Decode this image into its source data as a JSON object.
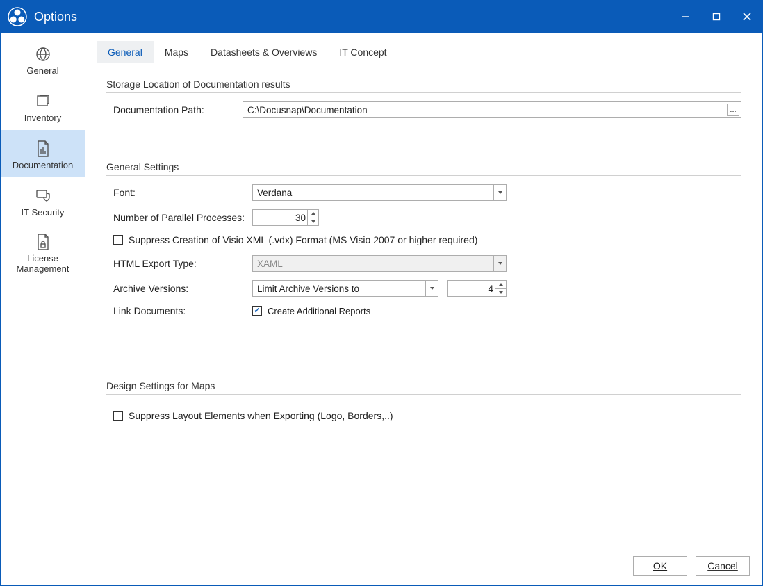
{
  "window": {
    "title": "Options"
  },
  "sidebar": {
    "items": [
      {
        "label": "General"
      },
      {
        "label": "Inventory"
      },
      {
        "label": "Documentation"
      },
      {
        "label": "IT Security"
      },
      {
        "label": "License Management"
      }
    ]
  },
  "tabs": [
    {
      "label": "General"
    },
    {
      "label": "Maps"
    },
    {
      "label": "Datasheets & Overviews"
    },
    {
      "label": "IT Concept"
    }
  ],
  "sections": {
    "storage": {
      "title": "Storage Location of Documentation results",
      "path_label": "Documentation Path:",
      "path_value": "C:\\Docusnap\\Documentation"
    },
    "general": {
      "title": "General Settings",
      "font_label": "Font:",
      "font_value": "Verdana",
      "procs_label": "Number of Parallel Processes:",
      "procs_value": "30",
      "suppress_visio": "Suppress Creation of Visio XML (.vdx) Format (MS Visio 2007 or higher required)",
      "export_type_label": "HTML Export Type:",
      "export_type_value": "XAML",
      "archive_label": "Archive Versions:",
      "archive_value": "Limit Archive Versions to",
      "archive_count": "4",
      "link_docs_label": "Link Documents:",
      "create_reports": "Create Additional Reports"
    },
    "maps": {
      "title": "Design Settings for Maps",
      "suppress_layout": "Suppress Layout Elements when Exporting (Logo, Borders,..)"
    }
  },
  "footer": {
    "ok": "OK",
    "cancel": "Cancel"
  }
}
